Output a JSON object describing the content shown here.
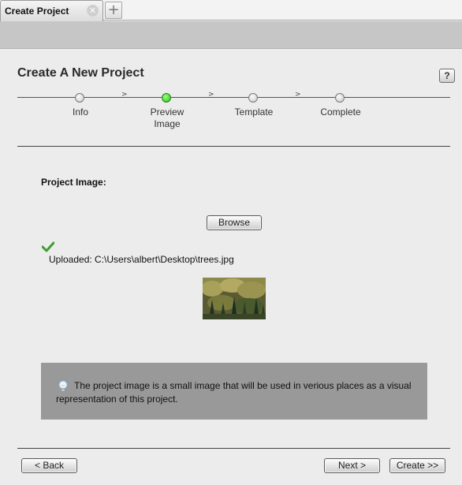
{
  "tabs": {
    "active_label": "Create Project",
    "close_glyph": "✕",
    "add_glyph": "+"
  },
  "page": {
    "title": "Create A New Project",
    "help_label": "?"
  },
  "wizard": {
    "current_step": 1,
    "arrow_glyph": ">",
    "steps": [
      {
        "label": "Info"
      },
      {
        "label": "Preview\nImage"
      },
      {
        "label": "Template"
      },
      {
        "label": "Complete"
      }
    ],
    "active_color": "#22c71f"
  },
  "form": {
    "project_image_label": "Project Image:",
    "browse_label": "Browse",
    "uploaded_text": "Uploaded: C:\\Users\\albert\\Desktop\\trees.jpg",
    "status_icon": "checkmark-icon",
    "thumbnail_icon": "forest-image"
  },
  "tip": {
    "icon": "lightbulb-icon",
    "text": "The project image is a small image that will be used in verious places as a visual representation of this project."
  },
  "footer": {
    "back_label": "< Back",
    "next_label": "Next >",
    "create_label": "Create >>"
  },
  "colors": {
    "tip_background": "#999999",
    "panel_background": "#ececec",
    "toolstrip": "#c6c6c6"
  }
}
